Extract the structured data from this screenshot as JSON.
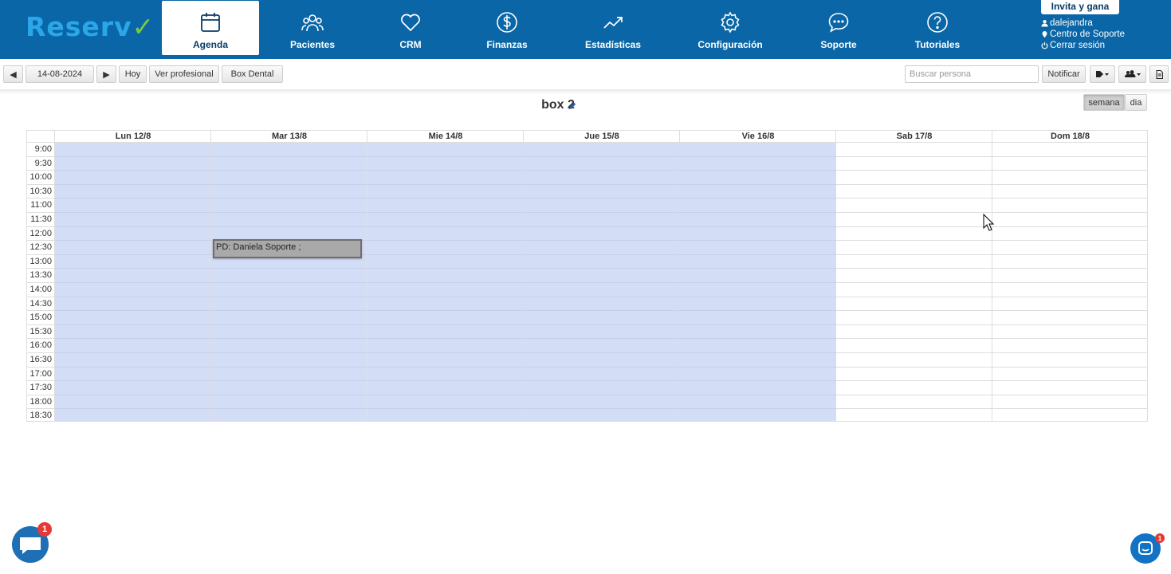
{
  "nav": {
    "items": [
      {
        "label": "Agenda",
        "icon": "calendar-icon",
        "active": true
      },
      {
        "label": "Pacientes",
        "icon": "users-icon"
      },
      {
        "label": "CRM",
        "icon": "heart-icon"
      },
      {
        "label": "Finanzas",
        "icon": "dollar-icon"
      },
      {
        "label": "Estadísticas",
        "icon": "trend-chart-icon"
      },
      {
        "label": "Configuración",
        "icon": "gear-icon"
      },
      {
        "label": "Soporte",
        "icon": "chat-bubble-icon"
      },
      {
        "label": "Tutoriales",
        "icon": "help-icon"
      }
    ],
    "invite_label": "Invita y gana",
    "user": {
      "username": "dalejandra",
      "support_center": "Centro de Soporte",
      "logout": "Cerrar sesión"
    }
  },
  "toolbar": {
    "prev_label": "◀",
    "date_value": "14-08-2024",
    "next_label": "▶",
    "today_label": "Hoy",
    "professional_label": "Ver profesional",
    "box_label": "Box Dental",
    "search_placeholder": "Buscar persona",
    "notify_label": "Notificar"
  },
  "calendar": {
    "title": "box 2",
    "view_week": "semana",
    "view_day": "dia",
    "days": [
      "Lun 12/8",
      "Mar 13/8",
      "Mie 14/8",
      "Jue 15/8",
      "Vie 16/8",
      "Sab 17/8",
      "Dom 18/8"
    ],
    "times": [
      "9:00",
      "9:30",
      "10:00",
      "10:30",
      "11:00",
      "11:30",
      "12:00",
      "12:30",
      "13:00",
      "13:30",
      "14:00",
      "14:30",
      "15:00",
      "15:30",
      "16:00",
      "16:30",
      "17:00",
      "17:30",
      "18:00",
      "18:30"
    ],
    "event": {
      "text": "PD: Daniela Soporte ;",
      "day": "Mar 13/8",
      "start": "12:30"
    }
  },
  "chat_widgets": {
    "left_badge": "1",
    "right_badge": "1"
  },
  "colors": {
    "nav_bg": "#0a66a6",
    "available_slot": "#d3def6",
    "event_bg": "#a9a9a9"
  }
}
